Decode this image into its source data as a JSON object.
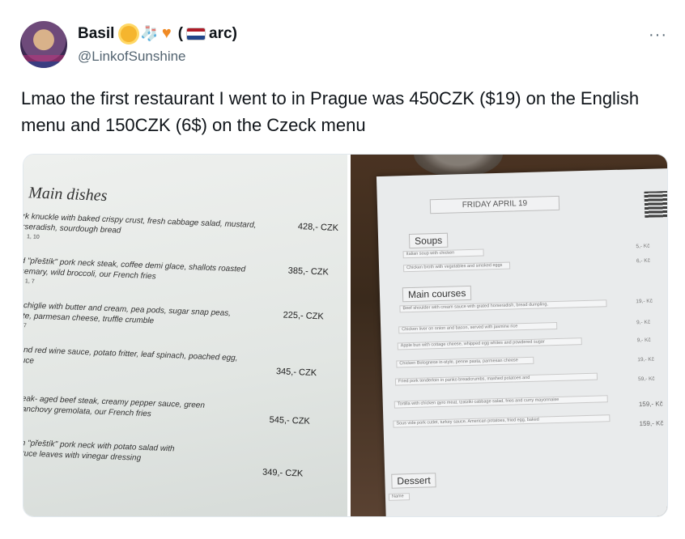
{
  "tweet": {
    "display_name": "Basil",
    "name_suffix": "(",
    "name_suffix_2": "arc)",
    "handle": "@LinkofSunshine",
    "more": "···",
    "text": "Lmao the first restaurant I went to in Prague was 450CZK ($19) on the English menu and 150CZK (6$) on the Czeck menu"
  },
  "left_menu": {
    "title": "Main dishes",
    "items": [
      {
        "text": "ork knuckle with baked crispy crust, fresh cabbage salad, mustard,\norseradish, sourdough bread",
        "price": "428,- CZK",
        "code": "1, 10"
      },
      {
        "text": "ed \"přeštík\" pork neck steak, coffee demi glace, shallots roasted\nosemary, wild broccoli, our French fries",
        "price": "385,- CZK",
        "code": "1, 7"
      },
      {
        "text": "onchiglie with butter and cream, pea pods, sugar snap peas,\naste, parmesan cheese, truffle crumble",
        "price": "225,- CZK",
        "code": "7"
      },
      {
        "text": "s and red wine sauce, potato fritter, leaf spinach, poached egg,\nsauce",
        "price": "345,- CZK",
        "code": ""
      },
      {
        "text": "psteak- aged beef steak, creamy pepper sauce, green\nnd anchovy gremolata, our French fries",
        "price": "545,- CZK",
        "code": ""
      },
      {
        "text": "from \"přeštík\" pork neck with potato salad with\n, lettuce leaves with vinegar dressing",
        "price": "349,- CZK",
        "code": ""
      }
    ]
  },
  "right_menu": {
    "header": "FRIDAY APRIL 19",
    "sections": [
      {
        "label": "Soups"
      },
      {
        "label": "Main courses"
      },
      {
        "label": "Dessert"
      }
    ],
    "soup_lines": [
      "Italian soup with chicken",
      "Chicken broth with vegetables and smoked eggs"
    ],
    "soup_prices": [
      "5,- Kč",
      "6,- Kč"
    ],
    "main_lines": [
      "Beef shoulder with cream sauce with grated horseradish, bread dumpling,",
      "Chicken liver on onion and bacon, served with jasmine rice",
      "Apple bun with cottage cheese, whipped egg whites and powdered sugar",
      "Chicken Bolognese in-style, penne pasta, parmesan cheese",
      "Fried pork tenderloin in panko breadcrumbs, mashed potatoes and",
      "Tortilla with chicken gyro meat, tzatziki cabbage salad, fries and curry mayonnaise",
      "Sous vide pork cutlet, turkey sauce, American potatoes, fried egg, baked"
    ],
    "main_prices": [
      "19,- Kč",
      "9,- Kč",
      "9,- Kč",
      "19,- Kč",
      "59,- Kč",
      "159,- Kč",
      "159,- Kč"
    ],
    "dessert_lines": [
      "Name"
    ]
  },
  "colors": {
    "name_text": "#0f1419",
    "handle_text": "#536471",
    "flag_red": "#ae1c28",
    "flag_white": "#ffffff",
    "flag_blue": "#21468b"
  }
}
